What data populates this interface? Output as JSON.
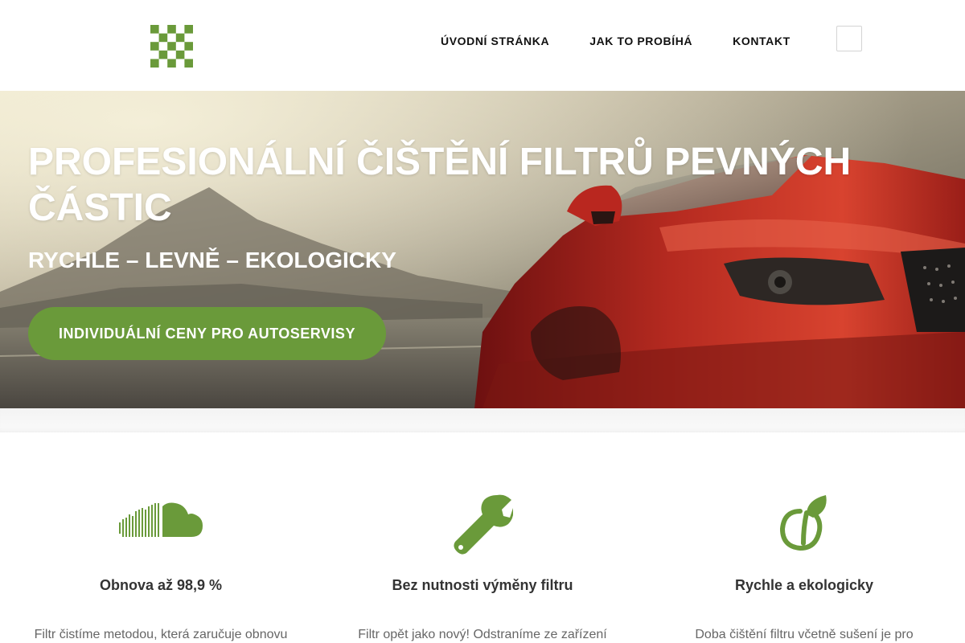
{
  "header": {
    "logo_icon": "checkered-logo-icon",
    "nav": [
      {
        "label": "ÚVODNÍ STRÁNKA"
      },
      {
        "label": "JAK TO PROBÍHÁ"
      },
      {
        "label": "KONTAKT"
      }
    ],
    "menu_icon": "menu-toggle-icon"
  },
  "hero": {
    "title": "PROFESIONÁLNÍ ČIŠTĚNÍ FILTRŮ PEVNÝCH ČÁSTIC",
    "subtitle": "RYCHLE – LEVNĚ – EKOLOGICKY",
    "cta_label": "INDIVIDUÁLNÍ CENY PRO AUTOSERVISY",
    "background": "red-car-on-road-image"
  },
  "features": [
    {
      "icon": "soundcloud-icon",
      "title": "Obnova až 98,9 %",
      "text": "Filtr čistíme metodou, která zaručuje obnovu"
    },
    {
      "icon": "wrench-icon",
      "title": "Bez nutnosti výměny filtru",
      "text": "Filtr opět jako nový! Odstraníme ze zařízení"
    },
    {
      "icon": "leaf-apple-icon",
      "title": "Rychle a ekologicky",
      "text": "Doba čištění filtru včetně sušení je pro"
    }
  ],
  "colors": {
    "accent": "#6a9a3a",
    "text_dark": "#333333",
    "text_muted": "#666666"
  }
}
